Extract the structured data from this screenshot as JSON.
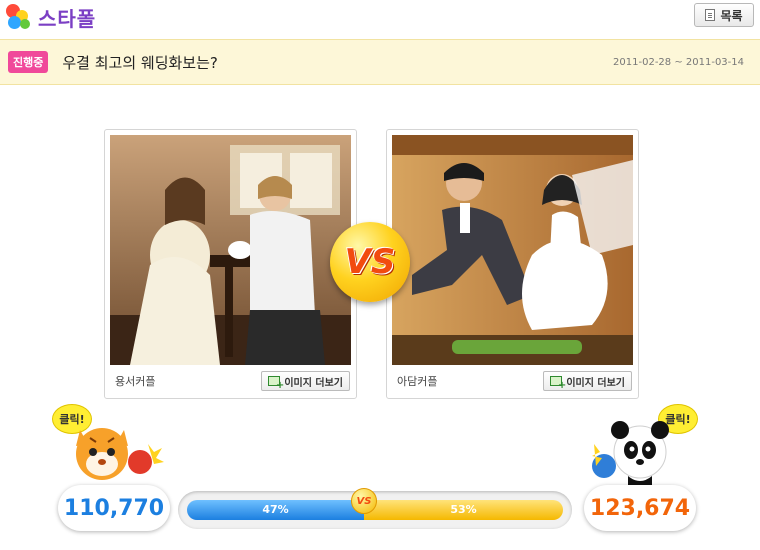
{
  "header": {
    "logo_text": "스타폴",
    "list_button_label": "목록"
  },
  "poll": {
    "status_badge": "진행중",
    "title": "우결 최고의 웨딩화보는?",
    "date_range": "2011-02-28 ~ 2011-03-14"
  },
  "candidates": [
    {
      "name": "용서커플",
      "more_images_label": "이미지 더보기",
      "votes": "110,770",
      "percent": 47,
      "percent_label": "47%",
      "accent_color": "#1c7fe0",
      "mascot_icon": "tiger-mascot-icon",
      "click_label": "클릭!"
    },
    {
      "name": "아담커플",
      "more_images_label": "이미지 더보기",
      "votes": "123,674",
      "percent": 53,
      "percent_label": "53%",
      "accent_color": "#f2650a",
      "mascot_icon": "panda-mascot-icon",
      "click_label": "클릭!"
    }
  ],
  "versus_label": "VS",
  "versus_small_label": "VS"
}
